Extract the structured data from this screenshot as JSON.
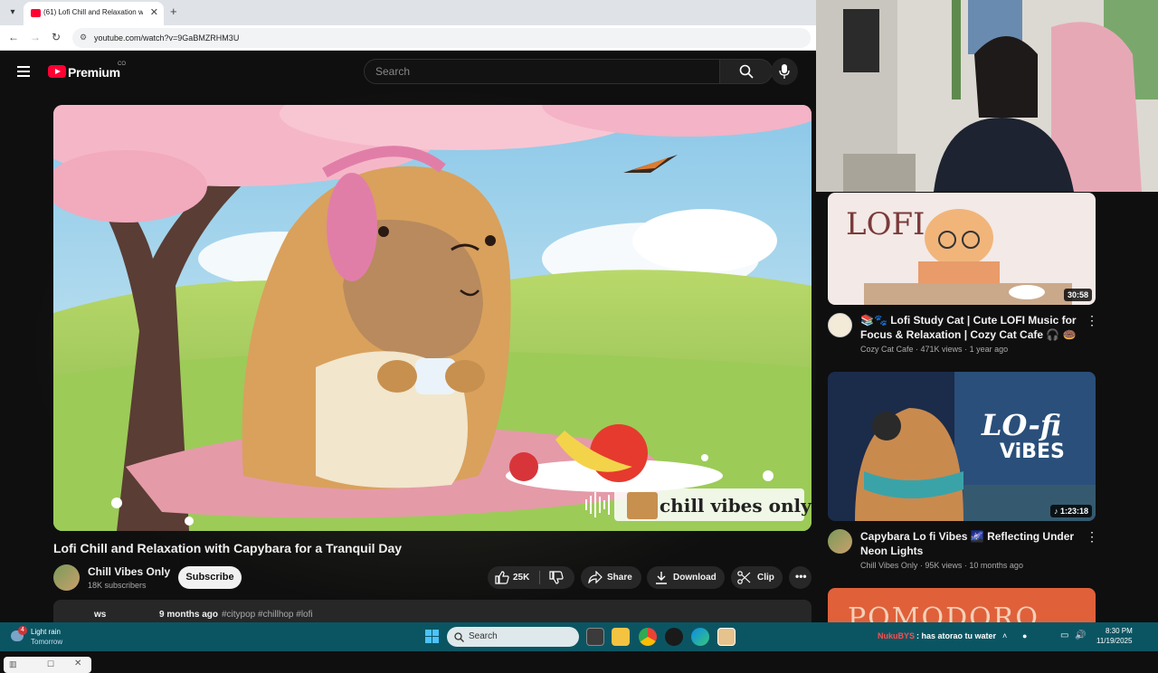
{
  "browser": {
    "tab_title": "(61) Lofi Chill and Relaxation w",
    "url": "youtube.com/watch?v=9GaBMZRHM3U"
  },
  "youtube": {
    "logo_text": "Premium",
    "logo_suffix": "CO",
    "search_placeholder": "Search",
    "video": {
      "title": "Lofi Chill and Relaxation with Capybara for a Tranquil Day",
      "overlay_text": "chill vibes only",
      "channel": "Chill Vibes Only",
      "subscribers": "18K subscribers",
      "subscribe_label": "Subscribe",
      "likes": "25K",
      "share_label": "Share",
      "download_label": "Download",
      "clip_label": "Clip",
      "views_partial": "ws",
      "age": "9 months ago",
      "tags": "#citypop #chillhop #lofi"
    },
    "sidebar": [
      {
        "title": "📚🐾 Lofi Study Cat | Cute LOFI Music for Focus & Relaxation | Cozy Cat Cafe 🎧 🍩",
        "channel": "Cozy Cat Cafe",
        "views": "471K views",
        "age": "1 year ago",
        "duration": "30:58",
        "thumb_text": "LOFI"
      },
      {
        "title": "Capybara Lo fi Vibes 🌌 Reflecting Under Neon Lights",
        "channel": "Chill Vibes Only",
        "views": "95K views",
        "age": "10 months ago",
        "duration": "1:23:18",
        "thumb_text_1": "LO-fi",
        "thumb_text_2": "ViBES"
      },
      {
        "thumb_text": "POMODORO"
      }
    ]
  },
  "taskbar": {
    "weather_badge": "4",
    "weather_line1": "Light rain",
    "weather_line2": "Tomorrow",
    "search_label": "Search",
    "chat_name": "NukuBYS",
    "chat_message": ": has atorao tu water",
    "time": "8:30 PM",
    "date": "11/19/2025"
  },
  "colors": {
    "yt_red": "#ff0033",
    "bg": "#0f0f0f",
    "taskbar": "#0b5563"
  }
}
